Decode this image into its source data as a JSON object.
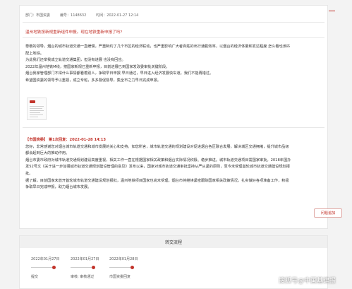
{
  "meta": {
    "department": "部门：市国资委",
    "number": "编号：1148632",
    "time": "时间：2022-01-27 12:14"
  },
  "message": {
    "title": "温州地铁按新规重新组件申报。现在地铁重新申报了吗?",
    "body": [
      "尊敬的领导，烟台的城市轨道交通一直缓慢，严重制约了几个市区的经济联动，也严重影响广大者百姓的出行通勤效率，以烟台的经济体量和发达程度 怎么看也该匹",
      "配上地铁。",
      "为此我们还举我成立轨道交通集团，但没有进展 也没有回应。",
      "2022年温州地铁M线，按国家新规已重新申报，目前进展已到国家发改委审批关键阶段。",
      "烟台我家管理部门不得什么事情都看着别人，争取早日申报 早日通过，早日进入经济发展快车道。我们不能再错过。",
      "希望国资委的领导予以重视，成立专班，多多督促督导，集全市之力早日完成申报。"
    ]
  },
  "reply": {
    "head": "【市国资委】 第1次回复：2022-01-28 14:13",
    "body": [
      "您好，非常感谢您对烟台城市轨道交通和城市发展的关心和支持。如您所言，城市轨道交通的规划建设对促进烟台各区融合发展，解决城区交通拥堵，提升城市品级",
      "都会起到巨大的推动作用。",
      "烟台市委市政府对城市轨道交通规划建设高度重视，相关工作一直在根据国家相关政策和烟台实际情况积极、稳步推进。城市轨道交通项目需国家审批。2018年国办",
      "发52号文《关于进一步加强城市轨道交通规划建设管理的意见》发布以来，国家对城市轨道交通审批坚持从严从紧的原则，至今未受理首轮城市轨道交通建设规划报",
      "批。",
      "据了解，目前国家未放开首轮城市轨道交通建设规划报批，温州地铁项目国家也尚未受理。烟台市将继续紧密跟踪国家相关政策情况，扎实做好各项准备工作，积极",
      "争取早日完成申报，助力烟台城市发展。"
    ]
  },
  "button": {
    "label": "问题追加"
  },
  "flow": {
    "title": "转交流程",
    "steps": [
      {
        "date": "2022年01月27日",
        "label": "提交"
      },
      {
        "date": "2022年01月27日",
        "label": "审核: 审核通过"
      },
      {
        "date": "2022年01月28日",
        "label": "市国资委回复"
      }
    ]
  },
  "watermark": "搜狐号@中国基建报",
  "accent_color": "#c2332a"
}
